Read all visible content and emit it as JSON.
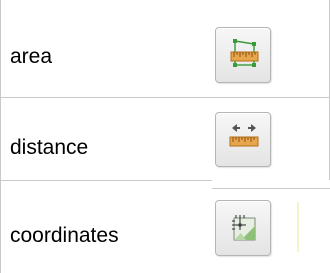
{
  "rows": [
    {
      "label": "area",
      "icon": "area-ruler-icon"
    },
    {
      "label": "distance",
      "icon": "distance-ruler-icon"
    },
    {
      "label": "coordinates",
      "icon": "coordinates-icon"
    }
  ],
  "colors": {
    "border": "#c9c9c9",
    "ruler": "#e39a3a",
    "measure-line": "#3a9a3a",
    "arrow": "#555555"
  }
}
